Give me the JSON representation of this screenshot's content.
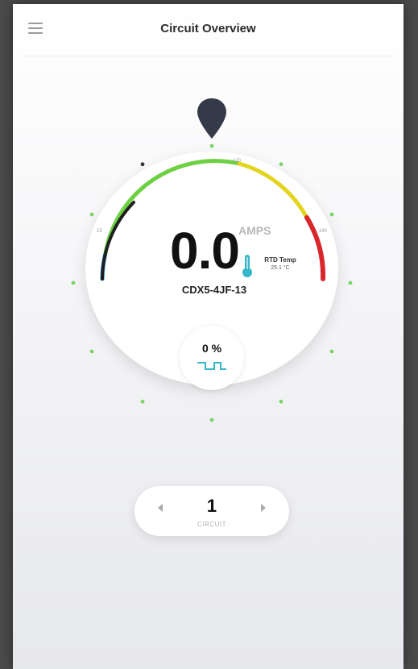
{
  "header": {
    "title": "Circuit Overview",
    "menu_icon": "hamburger-menu-icon"
  },
  "gauge": {
    "amps_value": "0.0",
    "amps_unit": "AMPS",
    "circuit_id": "CDX5-4JF-13",
    "rtd_label": "RTD Temp",
    "rtd_value": "25.1 °C",
    "tick_labels": [
      "15",
      "120",
      "140"
    ],
    "colors": {
      "low": "#1a9be0",
      "mid": "#6dd143",
      "high": "#e3d51d",
      "critical": "#d9262b",
      "indicator": "#1f1f1f",
      "dot": "#7cd36a",
      "pin": "#343a48"
    }
  },
  "duty_cycle": {
    "value": "0 %",
    "icon": "pulse-wave-icon",
    "icon_color": "#35b6c9"
  },
  "selector": {
    "value": "1",
    "label": "CIRCUIT",
    "prev_icon": "arrow-left-icon",
    "next_icon": "arrow-right-icon"
  }
}
